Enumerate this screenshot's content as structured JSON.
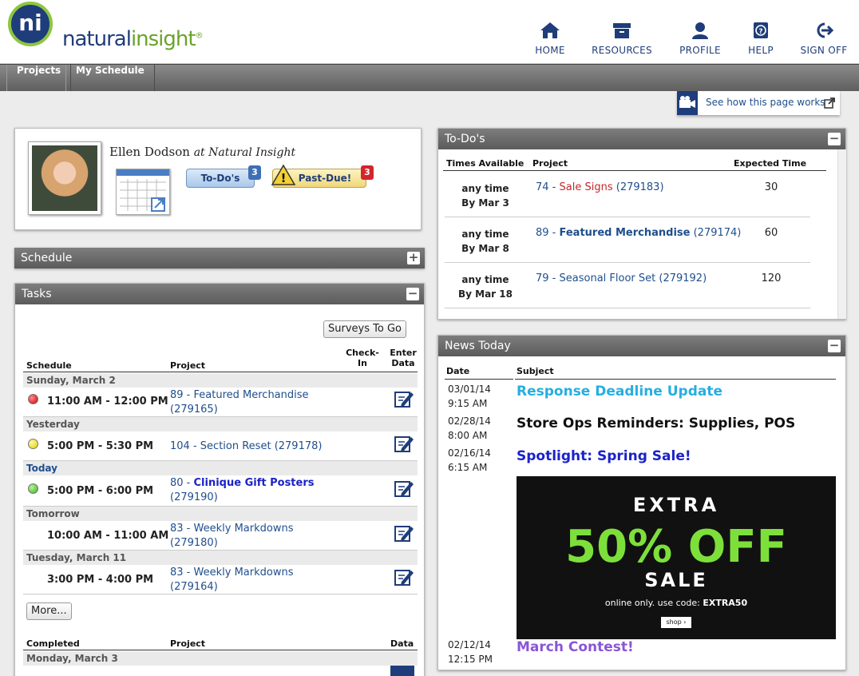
{
  "header": {
    "logo_mark": "ni",
    "logo_text_a": "natural",
    "logo_text_b": "insight",
    "logo_reg": "®",
    "nav": [
      {
        "label": "HOME",
        "icon": "home-icon"
      },
      {
        "label": "RESOURCES",
        "icon": "resources-icon"
      },
      {
        "label": "PROFILE",
        "icon": "profile-icon"
      },
      {
        "label": "HELP",
        "icon": "help-icon"
      },
      {
        "label": "SIGN OFF",
        "icon": "sign-off-icon"
      }
    ]
  },
  "subnav": [
    {
      "label": "Projects"
    },
    {
      "label": "My Schedule"
    }
  ],
  "help_link": "See how this page works",
  "profile": {
    "name": "Ellen Dodson",
    "at": "at Natural Insight",
    "todos_label": "To-Do's",
    "todos_count": "3",
    "pastdue_label": "Past-Due!",
    "pastdue_count": "3"
  },
  "schedule_panel": {
    "title": "Schedule",
    "toggle": "+"
  },
  "tasks_panel": {
    "title": "Tasks",
    "toggle": "−",
    "surveys_button": "Surveys To Go",
    "columns": {
      "schedule": "Schedule",
      "project": "Project",
      "checkin_1": "Check-",
      "checkin_2": "In",
      "enter_1": "Enter",
      "enter_2": "Data"
    },
    "groups": [
      {
        "day": "Sunday, March 2",
        "today": false,
        "time": "11:00 AM - 12:00 PM",
        "status": "red",
        "proj_num": "89",
        "proj_sep": " - ",
        "proj_name": "Featured Merchandise",
        "proj_name_bold": false,
        "proj_id": "(279165)"
      },
      {
        "day": "Yesterday",
        "today": false,
        "time": "5:00 PM - 5:30 PM",
        "status": "yellow",
        "proj_num": "104",
        "proj_sep": " - ",
        "proj_name": "Section Reset",
        "proj_name_bold": false,
        "proj_id": "(279178)"
      },
      {
        "day": "Today",
        "today": true,
        "time": "5:00 PM - 6:00 PM",
        "status": "green",
        "proj_num": "80",
        "proj_sep": " - ",
        "proj_name": "Clinique Gift Posters",
        "proj_name_bold": true,
        "proj_id": "(279190)"
      },
      {
        "day": "Tomorrow",
        "today": false,
        "time": "10:00 AM - 11:00 AM",
        "status": "none",
        "proj_num": "83",
        "proj_sep": " - ",
        "proj_name": "Weekly Markdowns",
        "proj_name_bold": false,
        "proj_id": "(279180)"
      },
      {
        "day": "Tuesday, March 11",
        "today": false,
        "time": "3:00 PM - 4:00 PM",
        "status": "none",
        "proj_num": "83",
        "proj_sep": " - ",
        "proj_name": "Weekly Markdowns",
        "proj_name_bold": false,
        "proj_id": "(279164)"
      }
    ],
    "more_button": "More...",
    "completed": {
      "col_completed": "Completed",
      "col_project": "Project",
      "col_data": "Data",
      "first_day": "Monday, March 3"
    }
  },
  "todos_panel": {
    "title": "To-Do's",
    "toggle": "−",
    "columns": {
      "times": "Times Available",
      "project": "Project",
      "expected": "Expected Time"
    },
    "rows": [
      {
        "time": "any time",
        "by": "By Mar 3",
        "num": "74",
        "sep": " - ",
        "name": "Sale Signs",
        "name_style": "red",
        "id": "(279183)",
        "expected": "30"
      },
      {
        "time": "any time",
        "by": "By Mar 8",
        "num": "89",
        "sep": " - ",
        "name": "Featured Merchandise",
        "name_style": "bold",
        "id": "(279174)",
        "expected": "60"
      },
      {
        "time": "any time",
        "by": "By Mar 18",
        "num": "79",
        "sep": " - ",
        "name": "Seasonal Floor Set",
        "name_style": "normal",
        "id": "(279192)",
        "expected": "120"
      }
    ]
  },
  "news_panel": {
    "title": "News Today",
    "toggle": "−",
    "columns": {
      "date": "Date",
      "subject": "Subject"
    },
    "items": [
      {
        "date": "03/01/14",
        "time": "9:15 AM",
        "subject": "Response Deadline Update",
        "color": "#27aee0"
      },
      {
        "date": "02/28/14",
        "time": "8:00 AM",
        "subject": "Store Ops Reminders: Supplies, POS",
        "color": "#111111"
      },
      {
        "date": "02/16/14",
        "time": "6:15 AM",
        "subject": "Spotlight: Spring Sale!",
        "color": "#1b22c8"
      },
      {
        "date": "02/12/14",
        "time": "12:15 PM",
        "subject": "March Contest!",
        "color": "#8a55d6"
      }
    ],
    "promo": {
      "line1": "EXTRA",
      "line2": "50% OFF",
      "line3": "SALE",
      "line4_a": "online only. use code: ",
      "line4_b": "EXTRA50",
      "shop": "shop ›"
    }
  }
}
